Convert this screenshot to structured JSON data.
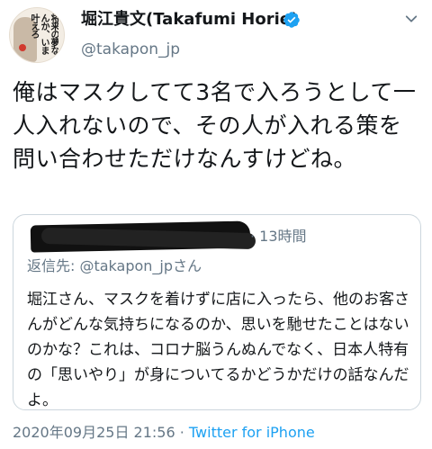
{
  "author": {
    "display_name": "堀江貴文(Takafumi Horie)",
    "handle": "@takapon_jp",
    "avatar_caption": "将来の夢なんか、いま叶えろ",
    "verified_icon": "verified-badge-icon",
    "verified_color": "#1da1f2"
  },
  "tweet": {
    "text": "俺はマスクしてて3名で入ろうとして一人入れないので、その人が入れる策を問い合わせただけなんすけどね。"
  },
  "quoted": {
    "time": "· 13時間",
    "reply_to": "返信先: @takapon_jpさん",
    "text": "堀江さん、マスクを着けずに店に入ったら、他のお客さんがどんな気持ちになるのか、思いを馳せたことはないのかな？これは、コロナ脳うんぬんでなく、日本人特有の「思いやり」が身についてるかどうかだけの話なんだよ。"
  },
  "meta": {
    "timestamp": "2020年09月25日 21:56 ·",
    "source": "Twitter for iPhone"
  },
  "colors": {
    "link": "#1da1f2",
    "muted": "#657786",
    "text": "#14171a",
    "border": "#ccd6dd"
  }
}
